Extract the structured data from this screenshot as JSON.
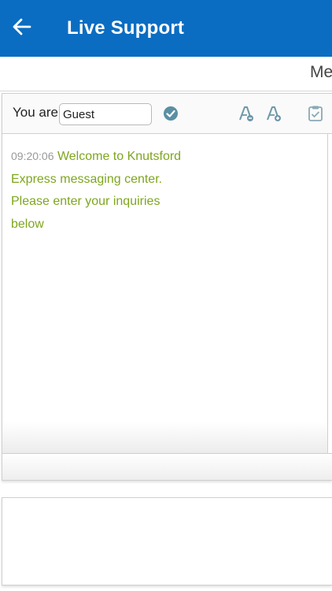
{
  "appbar": {
    "title": "Live Support",
    "back_icon": "arrow-left-icon"
  },
  "topstrip": {
    "partial_text": "Me"
  },
  "identity": {
    "label": "You are",
    "name_value": "Guest",
    "confirm_icon": "check-circle-icon",
    "font_decrease_icon": "font-decrease-icon",
    "font_increase_icon": "font-increase-icon",
    "transcript_icon": "transcript-icon"
  },
  "messages": [
    {
      "time": "09:20:06",
      "text": "Welcome to Knutsford Express messaging center. Please enter your inquiries below"
    }
  ],
  "colors": {
    "appbar": "#0a6dc2",
    "message_text": "#7ea61e",
    "timestamp": "#9a9a9a"
  }
}
